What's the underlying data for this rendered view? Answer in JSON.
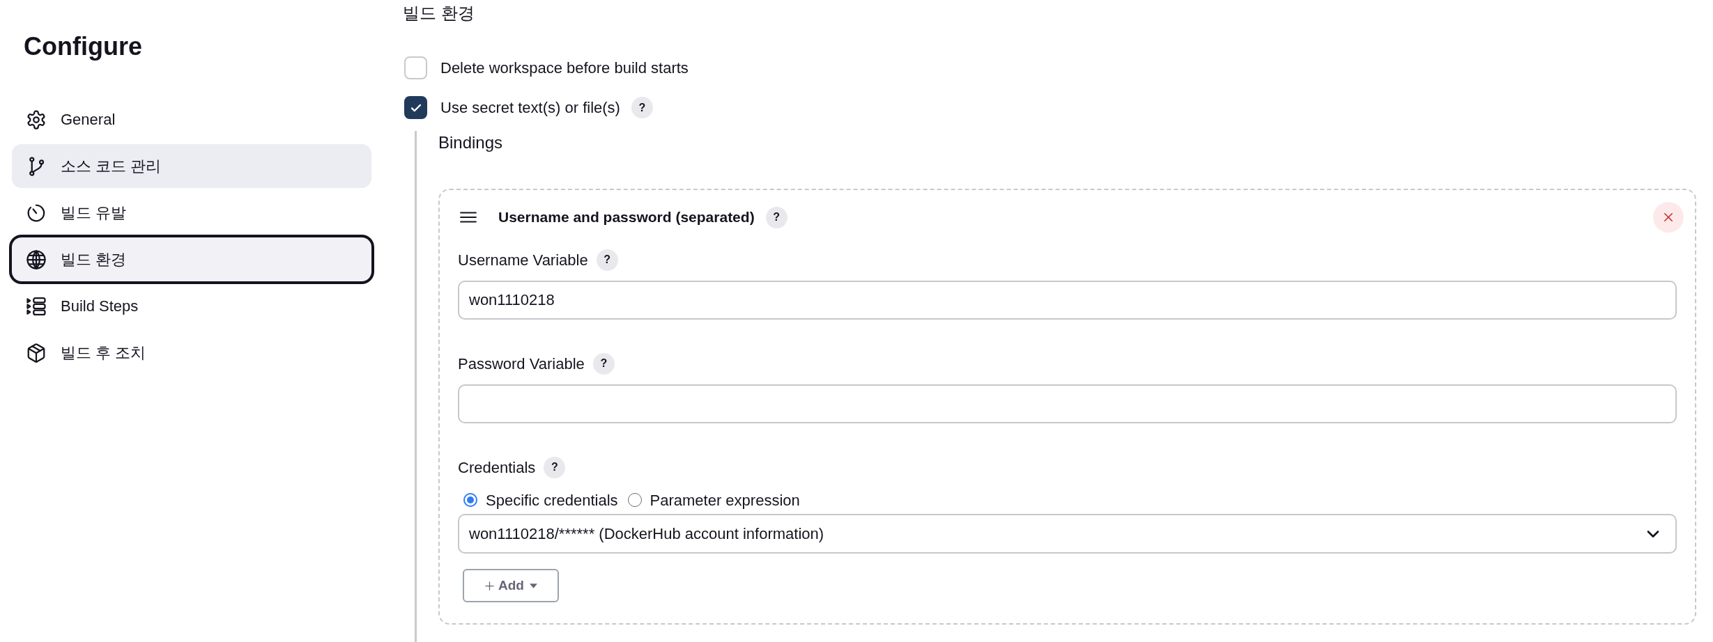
{
  "sidebar": {
    "title": "Configure",
    "items": [
      {
        "label": "General",
        "selected": false,
        "hovered": false
      },
      {
        "label": "소스 코드 관리",
        "selected": false,
        "hovered": true
      },
      {
        "label": "빌드 유발",
        "selected": false,
        "hovered": false
      },
      {
        "label": "빌드 환경",
        "selected": true,
        "hovered": false
      },
      {
        "label": "Build Steps",
        "selected": false,
        "hovered": false
      },
      {
        "label": "빌드 후 조치",
        "selected": false,
        "hovered": false
      }
    ]
  },
  "section": {
    "title": "빌드 환경",
    "options": [
      {
        "label": "Delete workspace before build starts",
        "checked": false
      },
      {
        "label": "Use secret text(s) or file(s)",
        "checked": true,
        "help": "?"
      }
    ]
  },
  "bindings": {
    "title": "Bindings",
    "items": [
      {
        "title": "Username and password (separated)",
        "help": "?",
        "fields": [
          {
            "kind": "text",
            "label": "Username Variable",
            "help": "?",
            "value": "won1110218"
          },
          {
            "kind": "text",
            "label": "Password Variable",
            "help": "?"
          },
          {
            "kind": "credentials",
            "label": "Credentials",
            "help": "?",
            "options": [
              {
                "label": "Specific credentials",
                "selected": true
              },
              {
                "label": "Parameter expression",
                "selected": false
              }
            ],
            "value": "won1110218/****** (DockerHub account information)",
            "button": "Add"
          }
        ]
      }
    ]
  }
}
